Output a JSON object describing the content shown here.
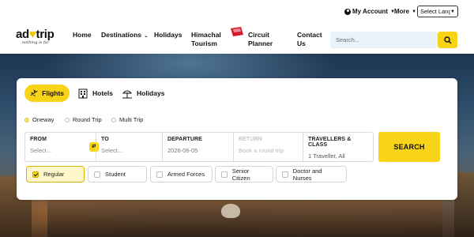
{
  "topbar": {
    "my_account": "My Account",
    "more": "More",
    "language": "Select Language"
  },
  "logo": {
    "text_pre": "ad",
    "text_post": "trip",
    "tagline": "nothing is far"
  },
  "nav": {
    "home": "Home",
    "destinations": "Destinations",
    "holidays": "Holidays",
    "himachal_line1": "Himachal",
    "himachal_line2": "Tourism",
    "circuit_line1": "Circuit",
    "circuit_line2": "Planner",
    "contact_line1": "Contact",
    "contact_line2": "Us"
  },
  "search": {
    "placeholder": "Search..."
  },
  "booking": {
    "tabs": [
      {
        "label": "Flights",
        "active": true
      },
      {
        "label": "Hotels",
        "active": false
      },
      {
        "label": "Holidays",
        "active": false
      }
    ],
    "trip_types": [
      {
        "label": "Oneway",
        "selected": true
      },
      {
        "label": "Round Trip",
        "selected": false
      },
      {
        "label": "Multi Trip",
        "selected": false
      }
    ],
    "fields": {
      "from": {
        "label": "FROM",
        "value": "Select..."
      },
      "to": {
        "label": "TO",
        "value": "Select..."
      },
      "departure": {
        "label": "DEPARTURE",
        "value": "2026-06-05"
      },
      "return": {
        "label": "RETURN",
        "value": "Book a round trip"
      },
      "travellers": {
        "label": "TRAVELLERS & CLASS",
        "value": "1 Traveller, All"
      }
    },
    "search_label": "SEARCH",
    "fare_types": [
      {
        "label": "Regular",
        "checked": true
      },
      {
        "label": "Student",
        "checked": false
      },
      {
        "label": "Armed Forces",
        "checked": false
      },
      {
        "label": "Senior Citizen",
        "checked": false
      },
      {
        "label": "Doctor and Nurses",
        "checked": false
      }
    ]
  },
  "colors": {
    "accent": "#f7d417",
    "search_bg": "#eaf3fb"
  }
}
